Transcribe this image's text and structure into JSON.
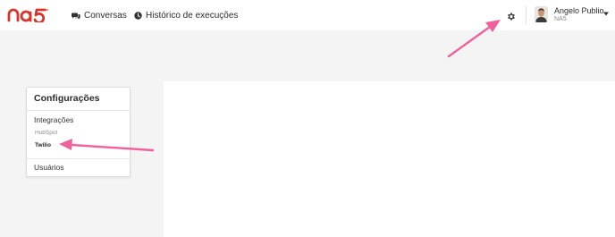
{
  "header": {
    "logo_text": "na5",
    "nav": [
      {
        "label": "Conversas",
        "icon": "chat-icon"
      },
      {
        "label": "Histórico de execuções",
        "icon": "clock-icon"
      }
    ],
    "settings_icon": "gear-icon",
    "user": {
      "name": "Angelo Publio",
      "org": "NA5"
    }
  },
  "settings_menu": {
    "title": "Configurações",
    "sections": [
      {
        "label": "Integrações",
        "items": [
          {
            "label": "HubSpot",
            "active": false
          },
          {
            "label": "Twilio",
            "active": true
          }
        ]
      },
      {
        "label": "Usuários",
        "items": []
      }
    ]
  },
  "annotations": {
    "arrow_color": "#f0609a"
  },
  "colors": {
    "brand": "#d9342b",
    "page_bg": "#f4f4f4",
    "panel_bg": "#ffffff"
  }
}
